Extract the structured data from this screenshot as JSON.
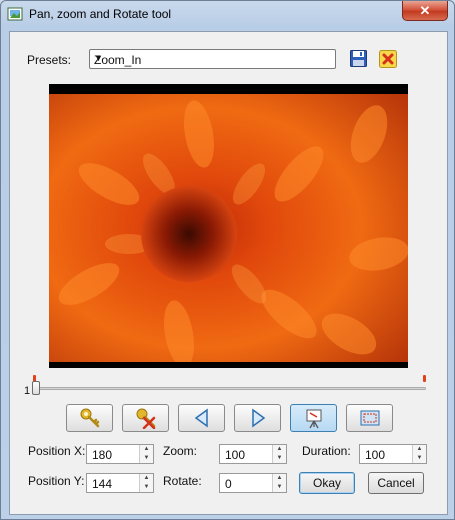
{
  "window": {
    "title": "Pan, zoom and Rotate tool",
    "close_glyph": "✕"
  },
  "presets": {
    "label": "Presets:",
    "selected": "Zoom_In"
  },
  "icons": {
    "app": "picture-icon",
    "save": "floppy-save-icon",
    "delete": "delete-x-icon"
  },
  "timeline": {
    "value": "1",
    "position_fraction": 0
  },
  "toolbar": [
    {
      "name": "add-keyframe-button",
      "icon": "key-icon"
    },
    {
      "name": "remove-keyframe-button",
      "icon": "key-remove-icon"
    },
    {
      "name": "previous-button",
      "icon": "triangle-left-icon"
    },
    {
      "name": "next-button",
      "icon": "triangle-right-icon"
    },
    {
      "name": "preview-button",
      "icon": "easel-icon",
      "pressed": true
    },
    {
      "name": "fit-frame-button",
      "icon": "frame-icon"
    }
  ],
  "fields": {
    "position_x": {
      "label": "Position X:",
      "value": "180"
    },
    "zoom": {
      "label": "Zoom:",
      "value": "100"
    },
    "duration": {
      "label": "Duration:",
      "value": "100"
    },
    "position_y": {
      "label": "Position Y:",
      "value": "144"
    },
    "rotate": {
      "label": "Rotate:",
      "value": "0"
    }
  },
  "buttons": {
    "okay": "Okay",
    "cancel": "Cancel"
  },
  "colors": {
    "accent_blue": "#3c7fb1",
    "marker_red": "#e0421c",
    "flower_orange": "#e8580f"
  }
}
